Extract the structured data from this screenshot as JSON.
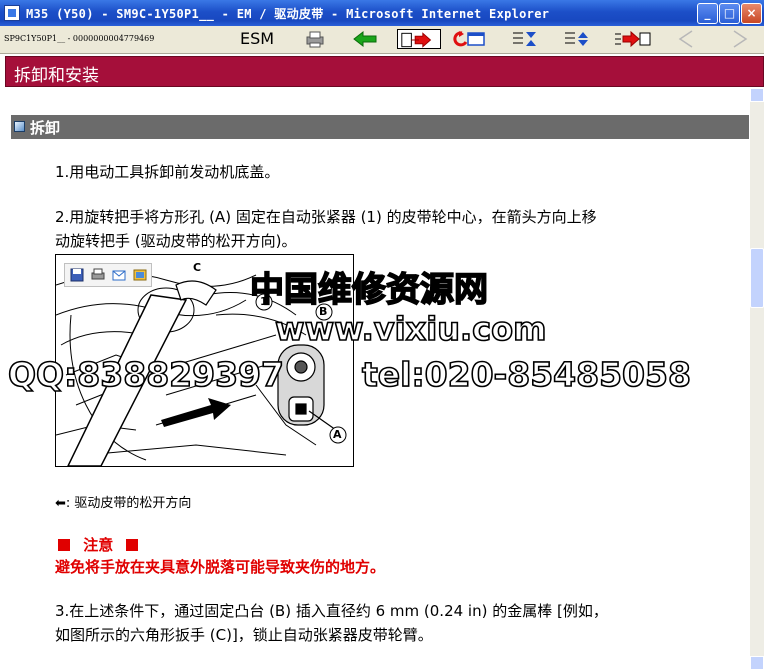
{
  "window": {
    "title": "M35 (Y50) - SM9C-1Y50P1__ - EM / 驱动皮带 - Microsoft Internet Explorer",
    "minimize": "_",
    "maximize": "□",
    "close": "×"
  },
  "toolbar": {
    "doc_id": "SP9C1Y50P1__ - 0000000004779469",
    "esm_label": "ESM"
  },
  "page": {
    "header": "拆卸和安装",
    "section": "拆卸"
  },
  "steps": {
    "s1": "1.用电动工具拆卸前发动机底盖。",
    "s2_line1": "2.用旋转把手将方形孔 (A) 固定在自动张紧器 (1) 的皮带轮中心，在箭头方向上移",
    "s2_line2": "动旋转把手 (驱动皮带的松开方向)。",
    "s3_line1": "3.在上述条件下，通过固定凸台 (B) 插入直径约  6 mm (0.24 in) 的金属棒  [例如，",
    "s3_line2": "如图所示的六角形扳手  (C)]，锁止自动张紧器皮带轮臂。"
  },
  "figure": {
    "label_c": "C",
    "label_1": "1",
    "label_b": "B",
    "label_a": "A"
  },
  "legend": {
    "arrow": "⬅",
    "text": ": 驱动皮带的松开方向"
  },
  "caution": {
    "title": "注意",
    "text": "避免将手放在夹具意外脱落可能导致夹伤的地方。"
  },
  "watermarks": {
    "w1": "中国维修资源网",
    "w2": "www.vixiu.com",
    "w3": "QQ:838829397",
    "w4": "tel:020-85485058"
  }
}
